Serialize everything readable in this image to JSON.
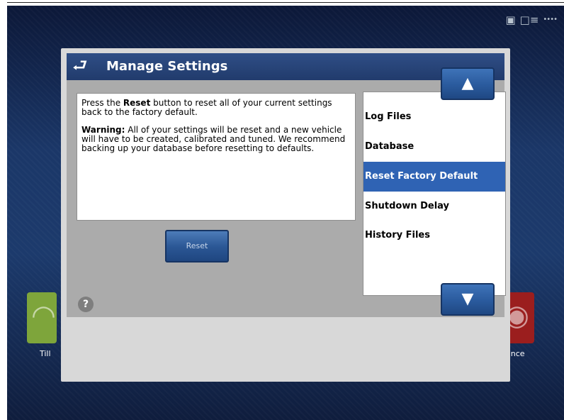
{
  "status_bar": {
    "icons": [
      "gps-icon",
      "display-icon",
      "signal-icon"
    ]
  },
  "home_tiles": {
    "left_label": "Till",
    "right_label": "ance"
  },
  "dialog": {
    "title": "Manage Settings",
    "info": {
      "line1_pre": "Press the ",
      "line1_bold": "Reset",
      "line1_post": " button to reset all of your current settings back to the factory default.",
      "warning_label": "Warning:",
      "warning_text": " All of your settings will be reset and a new vehicle will have to be created, calibrated and tuned. We recommend backing up your database before resetting to defaults."
    },
    "reset_button_label": "Reset",
    "list": {
      "items": [
        {
          "label": "Log Files"
        },
        {
          "label": "Database"
        },
        {
          "label": "Reset Factory Default"
        },
        {
          "label": "Shutdown Delay"
        },
        {
          "label": "History Files"
        }
      ],
      "selected_index": 2
    }
  },
  "colors": {
    "title_bar": "#2a4679",
    "selected_item": "#2f63b4",
    "button": "#2b5795"
  }
}
